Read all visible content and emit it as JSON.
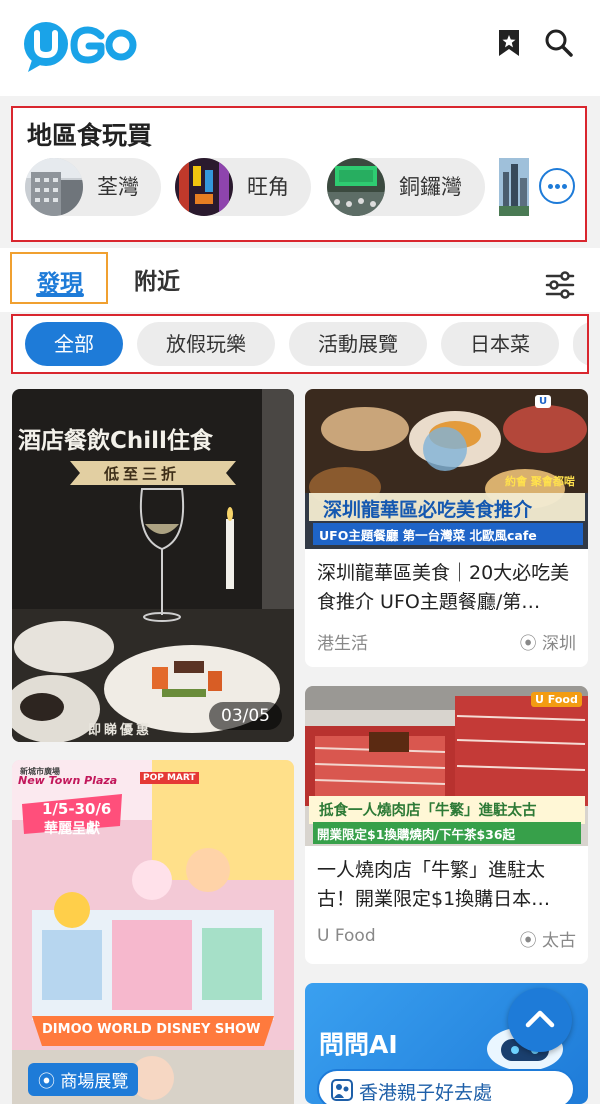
{
  "header": {
    "logo_text": "UGO",
    "bookmark_icon": "bookmark-icon",
    "search_icon": "search-icon"
  },
  "district_section": {
    "title": "地區食玩買",
    "chips": [
      {
        "label": "荃灣"
      },
      {
        "label": "旺角"
      },
      {
        "label": "銅鑼灣"
      }
    ],
    "more_icon": "more-icon"
  },
  "tabs": {
    "discover": "發現",
    "nearby": "附近",
    "filter_icon": "filter-icon"
  },
  "categories": [
    "全部",
    "放假玩樂",
    "活動展覽",
    "日本菜"
  ],
  "colors": {
    "accent": "#1e7bd8",
    "highlight_border": "#d9262e",
    "tab_border": "#f0a030"
  },
  "feed": {
    "left": [
      {
        "overlay_title": "酒店餐飲Chill住食",
        "overlay_subtitle": "低至三折",
        "overlay_footer": "即睇優惠",
        "page_badge": "03/05"
      },
      {
        "overlay_brand": "New Town Plaza",
        "overlay_brand_sub": "新城市廣場",
        "overlay_date": "1/5-30/6",
        "overlay_present": "華麗呈獻",
        "overlay_show": "DIMOO WORLD DISNEY SHOW",
        "overlay_popmart": "POP MART",
        "location_tag": "商場展覽"
      }
    ],
    "right": [
      {
        "banner_top": "深圳龍華區必吃美食推介",
        "banner_bottom": "UFO主題餐廳 第一台灣菜 北歐風cafe",
        "banner_tag": "約會 聚會都啱",
        "title": "深圳龍華區美食｜20大必吃美食推介 UFO主題餐廳/第…",
        "source": "港生活",
        "location": "深圳"
      },
      {
        "banner_top": "抵食一人燒肉店「牛繁」進駐太古",
        "banner_bottom": "開業限定$1換購燒肉/下午茶$36起",
        "brand": "U Food",
        "title": "一人燒肉店「牛繁」進駐太古！開業限定$1換購日本…",
        "source": "U Food",
        "location": "太古"
      }
    ]
  },
  "ai_card": {
    "title": "問問AI",
    "prompt": "香港親子好去處"
  },
  "scroll_top_icon": "arrow-up-icon"
}
